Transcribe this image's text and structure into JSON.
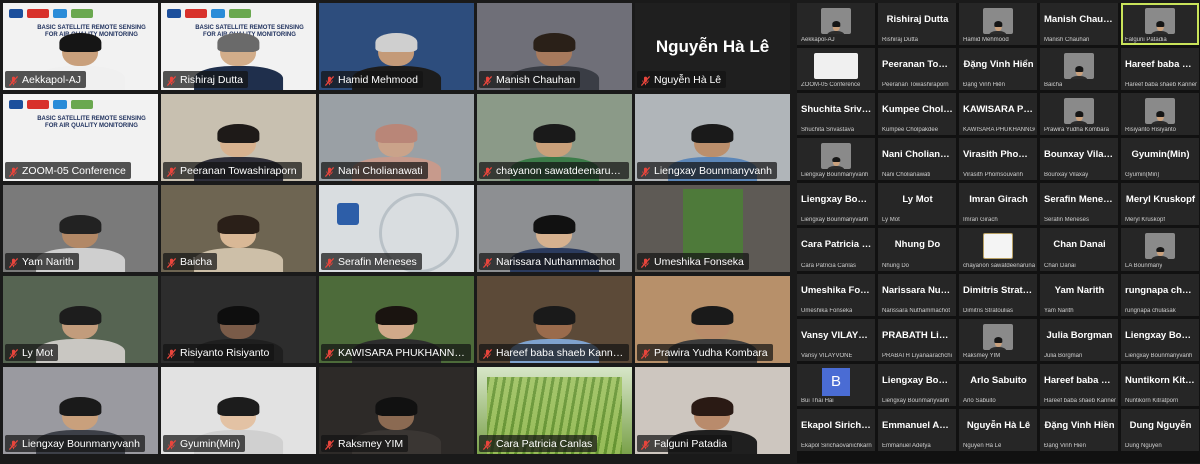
{
  "main_gallery": [
    {
      "name": "Aekkapol-AJ",
      "kind": "slide_cam",
      "active": true
    },
    {
      "name": "Rishiraj Dutta",
      "kind": "slide_cam"
    },
    {
      "name": "Hamid Mehmood",
      "kind": "video",
      "bg": "#2d4d7d",
      "skin": "#c49a78",
      "shirt": "#1c1c1c",
      "hair": "#cfcfcf"
    },
    {
      "name": "Manish Chauhan",
      "kind": "video",
      "bg": "#6f6f78",
      "skin": "#a77a5d",
      "shirt": "#3a3d45",
      "hair": "#2a2018"
    },
    {
      "name": "Nguyễn Hà Lê",
      "kind": "name_only"
    },
    {
      "name": "ZOOM-05 Conference",
      "kind": "slide"
    },
    {
      "name": "Peeranan Towashiraporn",
      "kind": "video",
      "bg": "#c8c0b0",
      "skin": "#d8b28f",
      "shirt": "#2f2f3a",
      "hair": "#1e1a18"
    },
    {
      "name": "Nani Cholianawati",
      "kind": "video",
      "bg": "#9aa0a5",
      "skin": "#caa38a",
      "shirt": "#c79a8c",
      "hair": "#b98678"
    },
    {
      "name": "chayanon sawatdeenarunat",
      "kind": "video",
      "bg": "#8b9a88",
      "skin": "#c9a07a",
      "shirt": "#3c7c49",
      "hair": "#1a1a1a"
    },
    {
      "name": "Liengxay Bounmanyvanh",
      "kind": "video",
      "bg": "#b0b5b9",
      "skin": "#bb8f6c",
      "shirt": "#5b86b8",
      "hair": "#1a1a1a"
    },
    {
      "name": "Yam Narith",
      "kind": "video",
      "bg": "#7a7a7a",
      "skin": "#b28866",
      "shirt": "#cfcfcf",
      "hair": "#222"
    },
    {
      "name": "Baicha",
      "kind": "video",
      "bg": "#6e6552",
      "skin": "#d9b896",
      "shirt": "#cdbfa8",
      "hair": "#2a1f18"
    },
    {
      "name": "Serafin Meneses",
      "kind": "logo_slide"
    },
    {
      "name": "Narissara Nuthammachot",
      "kind": "video",
      "bg": "#8d8f92",
      "skin": "#d6b18f",
      "shirt": "#2b3b5e",
      "hair": "#111"
    },
    {
      "name": "Umeshika Fonseka",
      "kind": "room"
    },
    {
      "name": "Ly Mot",
      "kind": "video",
      "bg": "#566452",
      "skin": "#c29c7c",
      "shirt": "#c9c7c2",
      "hair": "#1d1d1d"
    },
    {
      "name": "Risiyanto Risiyanto",
      "kind": "video",
      "bg": "#2d2d2d",
      "skin": "#7a5b48",
      "shirt": "#1f1f1f",
      "hair": "#0e0e0e"
    },
    {
      "name": "KAWISARA PHUKHANNGOEN",
      "kind": "video",
      "bg": "#4d6b3a",
      "skin": "#d1a98a",
      "shirt": "#2d2d2d",
      "hair": "#1a1410"
    },
    {
      "name": "Hareef baba shaeb Kannemadugu",
      "kind": "video",
      "bg": "#5c4a38",
      "skin": "#9a6b4c",
      "shirt": "#7fa3cf",
      "hair": "#1a1a1a"
    },
    {
      "name": "Prawira Yudha Kombara",
      "kind": "video",
      "bg": "#b7906a",
      "skin": "#b98c6a",
      "shirt": "#3b3b3b",
      "hair": "#1a1a1a"
    },
    {
      "name": "Liengxay Bounmanyvanh",
      "kind": "video",
      "bg": "#9a9aa0",
      "skin": "#c9a07c",
      "shirt": "#3d4048",
      "hair": "#1a1a1a"
    },
    {
      "name": "Gyumin(Min)",
      "kind": "video",
      "bg": "#e2e2e2",
      "skin": "#e3c2a4",
      "shirt": "#d0d0d0",
      "hair": "#1c1c1c"
    },
    {
      "name": "Raksmey YIM",
      "kind": "video",
      "bg": "#2d2a28",
      "skin": "#8b6a52",
      "shirt": "#3a3633",
      "hair": "#111"
    },
    {
      "name": "Cara Patricia Canlas",
      "kind": "plants"
    },
    {
      "name": "Falguni Patadia",
      "kind": "video",
      "bg": "#cdc6bf",
      "skin": "#b98b6c",
      "shirt": "#1f1f1f",
      "hair": "#2a1a14"
    }
  ],
  "slide": {
    "title": "BASIC SATELLITE REMOTE SENSING FOR AIR QUALITY MONITORING",
    "logo_colors": [
      "#1c4f9c",
      "#d8312b",
      "#2a8cd8",
      "#6aa84f"
    ]
  },
  "sidebar": [
    {
      "big": "",
      "small": "Aekkapol-AJ",
      "thumb": "person"
    },
    {
      "big": "Rishiraj Dutta",
      "small": "Rishiraj Dutta"
    },
    {
      "big": "",
      "small": "Hamid Mehmood",
      "thumb": "person"
    },
    {
      "big": "Manish Chauhan",
      "small": "Manish Chauhan"
    },
    {
      "big": "",
      "small": "Falguni Patadia",
      "thumb": "person",
      "active": true
    },
    {
      "big": "",
      "small": "ZOOM-05 Conference",
      "thumb": "slide"
    },
    {
      "big": "Peeranan Towas...",
      "small": "Peeranan Towashiraporn"
    },
    {
      "big": "Đặng Vinh Hiển",
      "small": "Đặng Vinh Hiển"
    },
    {
      "big": "",
      "small": "Baicha",
      "thumb": "person"
    },
    {
      "big": "Hareef baba shaeb...",
      "small": "Hareef baba shaeb Kannemadugu"
    },
    {
      "big": "Shuchita Srivast...",
      "small": "Shuchita Srivastava"
    },
    {
      "big": "Kumpee Cholpa...",
      "small": "Kumpee Cholpakdee"
    },
    {
      "big": "KAWISARA PHU...",
      "small": "KAWISARA PHUKHANNGOEN"
    },
    {
      "big": "",
      "small": "Prawira Yudha Kombara",
      "thumb": "person"
    },
    {
      "big": "",
      "small": "Risiyanto Risiyanto",
      "thumb": "person"
    },
    {
      "big": "",
      "small": "Liengxay Bounmanyvanh",
      "thumb": "person"
    },
    {
      "big": "Nani Cholianawati",
      "small": "Nani Cholianawati"
    },
    {
      "big": "Virasith Phomso...",
      "small": "Virasith Phomsouvanh"
    },
    {
      "big": "Bounxay Vilaxay",
      "small": "Bounxay Vilaxay"
    },
    {
      "big": "Gyumin(Min)",
      "small": "Gyumin(Min)"
    },
    {
      "big": "Liengxay Boun...",
      "small": "Liengxay Bounmanyvanh"
    },
    {
      "big": "Ly Mot",
      "small": "Ly Mot"
    },
    {
      "big": "Imran Girach",
      "small": "Imran Girach"
    },
    {
      "big": "Serafin Meneses",
      "small": "Serafin Meneses"
    },
    {
      "big": "Meryl Kruskopf",
      "small": "Meryl Kruskopf"
    },
    {
      "big": "Cara Patricia Ca...",
      "small": "Cara Patricia Canlas"
    },
    {
      "big": "Nhung Do",
      "small": "Nhung Do"
    },
    {
      "big": "",
      "small": "chayanon sawatdeenarunat",
      "thumb": "cmru"
    },
    {
      "big": "Chan Danai",
      "small": "Chan Danai"
    },
    {
      "big": "",
      "small": "LA Bounmany",
      "thumb": "person"
    },
    {
      "big": "Umeshika Fonseka",
      "small": "Umeshika Fonseka"
    },
    {
      "big": "Narissara Nutha...",
      "small": "Narissara Nuthammachot"
    },
    {
      "big": "Dimitris Stratoul...",
      "small": "Dimitris Stratoulias"
    },
    {
      "big": "Yam Narith",
      "small": "Yam Narith"
    },
    {
      "big": "rungnapa chulas...",
      "small": "rungnapa chulasak"
    },
    {
      "big": "Vansy VILAYVONE",
      "small": "Vansy VILAYVONE"
    },
    {
      "big": "PRABATH Liyan...",
      "small": "PRABATH Liyanaarachchi"
    },
    {
      "big": "",
      "small": "Raksmey YIM",
      "thumb": "person"
    },
    {
      "big": "Julia Borgman",
      "small": "Julia Borgman"
    },
    {
      "big": "Liengxay Boun...",
      "small": "Liengxay Bounmanyvanh"
    },
    {
      "big": "",
      "small": "Bui Thai Hai",
      "thumb": "letter",
      "letter": "B"
    },
    {
      "big": "Liengxay Boun...",
      "small": "Liengxay Bounmanyvanh"
    },
    {
      "big": "Arlo Sabuito",
      "small": "Arlo Sabuito"
    },
    {
      "big": "Hareef baba sha...",
      "small": "Hareef baba shaeb Kannemadugu"
    },
    {
      "big": "Nuntikorn Kitrat...",
      "small": "Nuntikorn Kitratporn"
    },
    {
      "big": "Ekapol Sirichaov...",
      "small": "Ekapol Sirichaovanichkarn"
    },
    {
      "big": "Emmanuel Adetya",
      "small": "Emmanuel Adetya"
    },
    {
      "big": "Nguyễn Hà Lê",
      "small": "Nguyễn Hà Lê"
    },
    {
      "big": "Đặng Vinh Hiền",
      "small": "Đặng Vinh Hiền"
    },
    {
      "big": "Dung Nguyễn",
      "small": "Dung Nguyễn"
    }
  ],
  "icons": {
    "muted_mic": "muted-microphone-icon"
  },
  "colors": {
    "active_speaker": "#c9e35a",
    "muted": "#e8453c",
    "background": "#1a1a1a",
    "placeholder_letter": "#4a6cd4"
  }
}
